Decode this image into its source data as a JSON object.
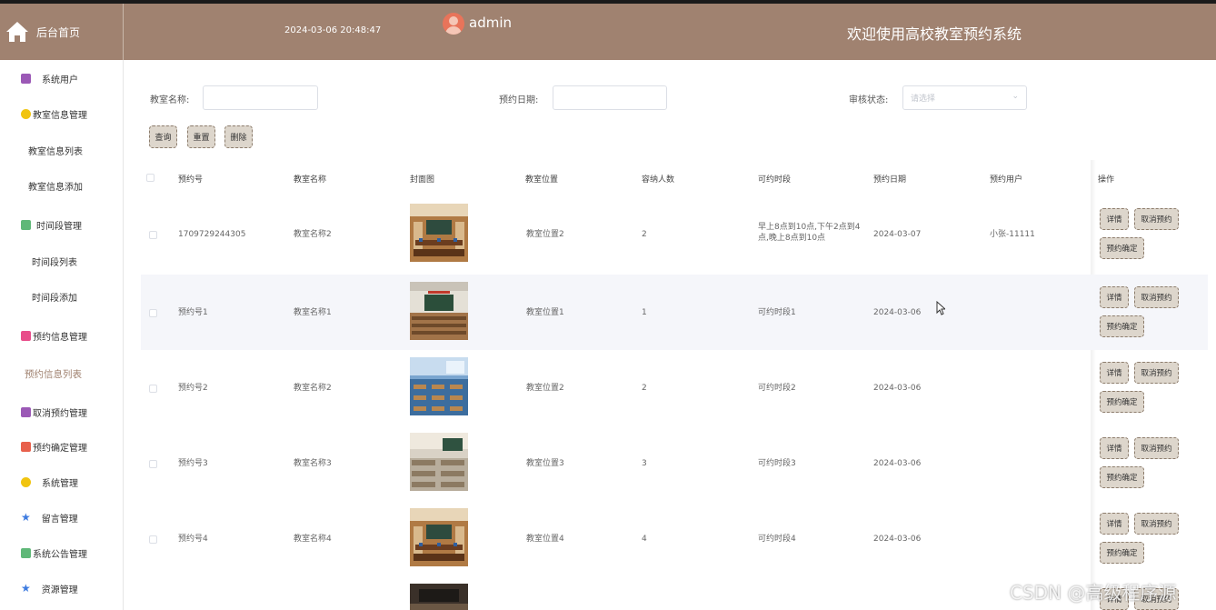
{
  "header": {
    "home_label": "后台首页",
    "datetime": "2024-03-06 20:48:47",
    "username": "admin",
    "system_title": "欢迎使用高校教室预约系统"
  },
  "sidebar": {
    "items": [
      {
        "label": "系统用户",
        "icon": "archive-icon",
        "color": "#9b59b6"
      },
      {
        "label": "教室信息管理",
        "icon": "hexagon-icon",
        "color": "#f1c40f"
      },
      {
        "label": "教室信息列表",
        "sub": true
      },
      {
        "label": "教室信息添加",
        "sub": true
      },
      {
        "label": "时间段管理",
        "icon": "chat-icon",
        "color": "#5fb878"
      },
      {
        "label": "时间段列表",
        "sub": true
      },
      {
        "label": "时间段添加",
        "sub": true
      },
      {
        "label": "预约信息管理",
        "icon": "clipboard-icon",
        "color": "#e84d8a"
      },
      {
        "label": "预约信息列表",
        "sub": true,
        "active": true
      },
      {
        "label": "取消预约管理",
        "icon": "archive-icon",
        "color": "#9b59b6"
      },
      {
        "label": "预约确定管理",
        "icon": "grid-icon",
        "color": "#e8604c"
      },
      {
        "label": "系统管理",
        "icon": "hexagon-icon",
        "color": "#f1c40f"
      },
      {
        "label": "留言管理",
        "icon": "star-icon",
        "color": "#3d7be0"
      },
      {
        "label": "系统公告管理",
        "icon": "chat-icon",
        "color": "#5fb878"
      },
      {
        "label": "资源管理",
        "icon": "star-icon",
        "color": "#3d7be0"
      }
    ]
  },
  "filters": {
    "classroom_name_label": "教室名称:",
    "date_label": "预约日期:",
    "status_label": "审核状态:",
    "status_placeholder": "请选择",
    "query_button": "查询",
    "reset_button": "重置",
    "delete_button": "删除"
  },
  "table": {
    "headers": [
      "预约号",
      "教室名称",
      "封面图",
      "教室位置",
      "容纳人数",
      "可约时段",
      "预约日期",
      "预约用户",
      "操作"
    ],
    "rows": [
      {
        "no": "1709729244305",
        "name": "教室名称2",
        "location": "教室位置2",
        "capacity": "2",
        "slot": "早上8点到10点,下午2点到4点,晚上8点到10点",
        "date": "2024-03-07",
        "user": "小张-11111",
        "img": "classroom-photo-warm"
      },
      {
        "no": "预约号1",
        "name": "教室名称1",
        "location": "教室位置1",
        "capacity": "1",
        "slot": "可约时段1",
        "date": "2024-03-06",
        "user": "",
        "img": "classroom-photo-green"
      },
      {
        "no": "预约号2",
        "name": "教室名称2",
        "location": "教室位置2",
        "capacity": "2",
        "slot": "可约时段2",
        "date": "2024-03-06",
        "user": "",
        "img": "classroom-photo-blue"
      },
      {
        "no": "预约号3",
        "name": "教室名称3",
        "location": "教室位置3",
        "capacity": "3",
        "slot": "可约时段3",
        "date": "2024-03-06",
        "user": "",
        "img": "classroom-photo-white"
      },
      {
        "no": "预约号4",
        "name": "教室名称4",
        "location": "教室位置4",
        "capacity": "4",
        "slot": "可约时段4",
        "date": "2024-03-06",
        "user": "",
        "img": "classroom-photo-warm"
      }
    ],
    "actions": {
      "detail": "详情",
      "cancel": "取消预约",
      "confirm": "预约确定"
    }
  },
  "watermark": "CSDN @高级程序源"
}
